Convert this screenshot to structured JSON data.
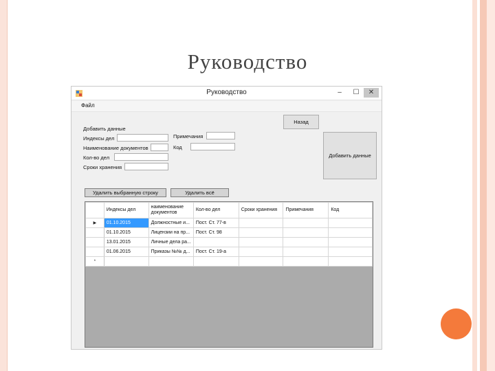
{
  "slide": {
    "title": "Руководство"
  },
  "window": {
    "title": "Руководство",
    "controls": {
      "minimize": "–",
      "maximize": "☐",
      "close": "✕"
    },
    "menu": [
      "Файл"
    ],
    "form": {
      "section_label": "Добавить данные",
      "labels": {
        "indices": "Индексы дел",
        "doc_name": "Наименование документов",
        "count": "Кол-во дел",
        "storage": "Сроки хранения",
        "notes": "Примечания",
        "code": "Код"
      },
      "values": {
        "indices": "",
        "doc_name": "",
        "count": "",
        "storage": "",
        "notes": "",
        "code": ""
      },
      "back_button": "Назад",
      "add_button": "Добавить данные",
      "delete_selected_button": "Удалить выбранную строку",
      "delete_all_button": "Удалить всё"
    },
    "grid": {
      "columns": [
        "Индексы дел",
        "наименование документов",
        "Кол-во дел",
        "Сроки хранения",
        "Примечания",
        "Код"
      ],
      "rows": [
        [
          "01.10.2015",
          "Должностные и...",
          "Пост. Ст. 77-в",
          "",
          "",
          ""
        ],
        [
          "01.10.2015",
          "Лицензии на пр...",
          "Пост. Ст. 98",
          "",
          "",
          ""
        ],
        [
          "13.01.2015",
          "Личные дела ра...",
          "",
          "",
          "",
          ""
        ],
        [
          "01.06.2015",
          "Приказы №№ д...",
          "Пост. Ст. 19-а",
          "",
          "",
          ""
        ],
        [
          "",
          "",
          "",
          "",
          "",
          ""
        ]
      ],
      "row_markers": [
        "▶",
        "",
        "",
        "",
        "*"
      ],
      "selected_row": 0,
      "selected_col": 0
    }
  }
}
